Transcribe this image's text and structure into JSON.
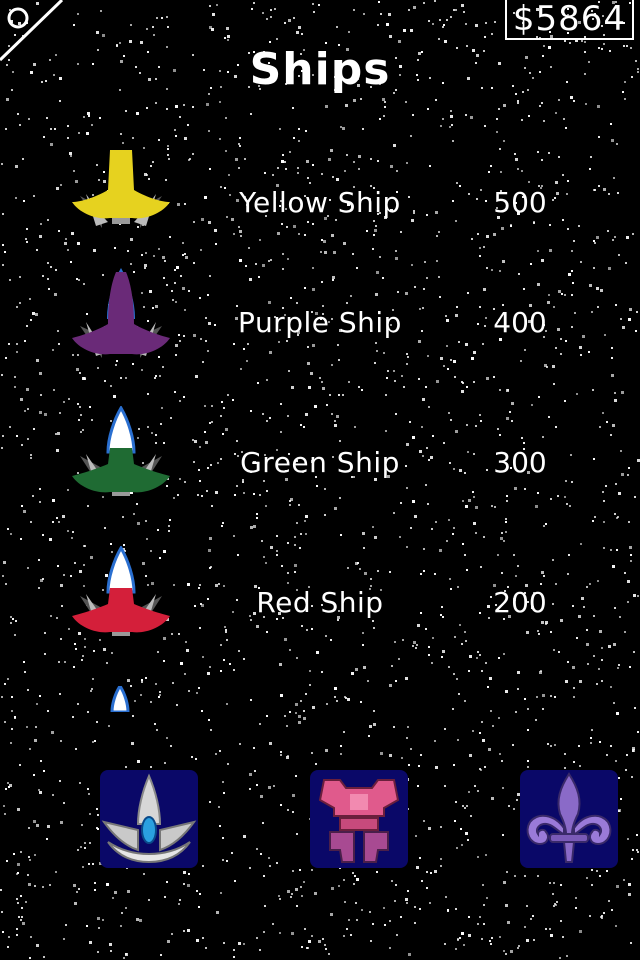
{
  "header": {
    "money": "$5864",
    "title": "Ships"
  },
  "ships": [
    {
      "name": "Yellow Ship",
      "price": "500",
      "color": "#e6d21f"
    },
    {
      "name": "Purple Ship",
      "price": "400",
      "color": "#6a2a78"
    },
    {
      "name": "Green Ship",
      "price": "300",
      "color": "#1f6b33"
    },
    {
      "name": "Red Ship",
      "price": "200",
      "color": "#d41f3a"
    }
  ],
  "tabs": [
    {
      "name": "ships",
      "icon": "silver-ship-icon"
    },
    {
      "name": "armor",
      "icon": "pink-armor-icon"
    },
    {
      "name": "emblems",
      "icon": "fleur-de-lis-icon"
    }
  ],
  "colors": {
    "background": "#000000",
    "tab_background": "#0a0868",
    "text": "#ffffff"
  }
}
